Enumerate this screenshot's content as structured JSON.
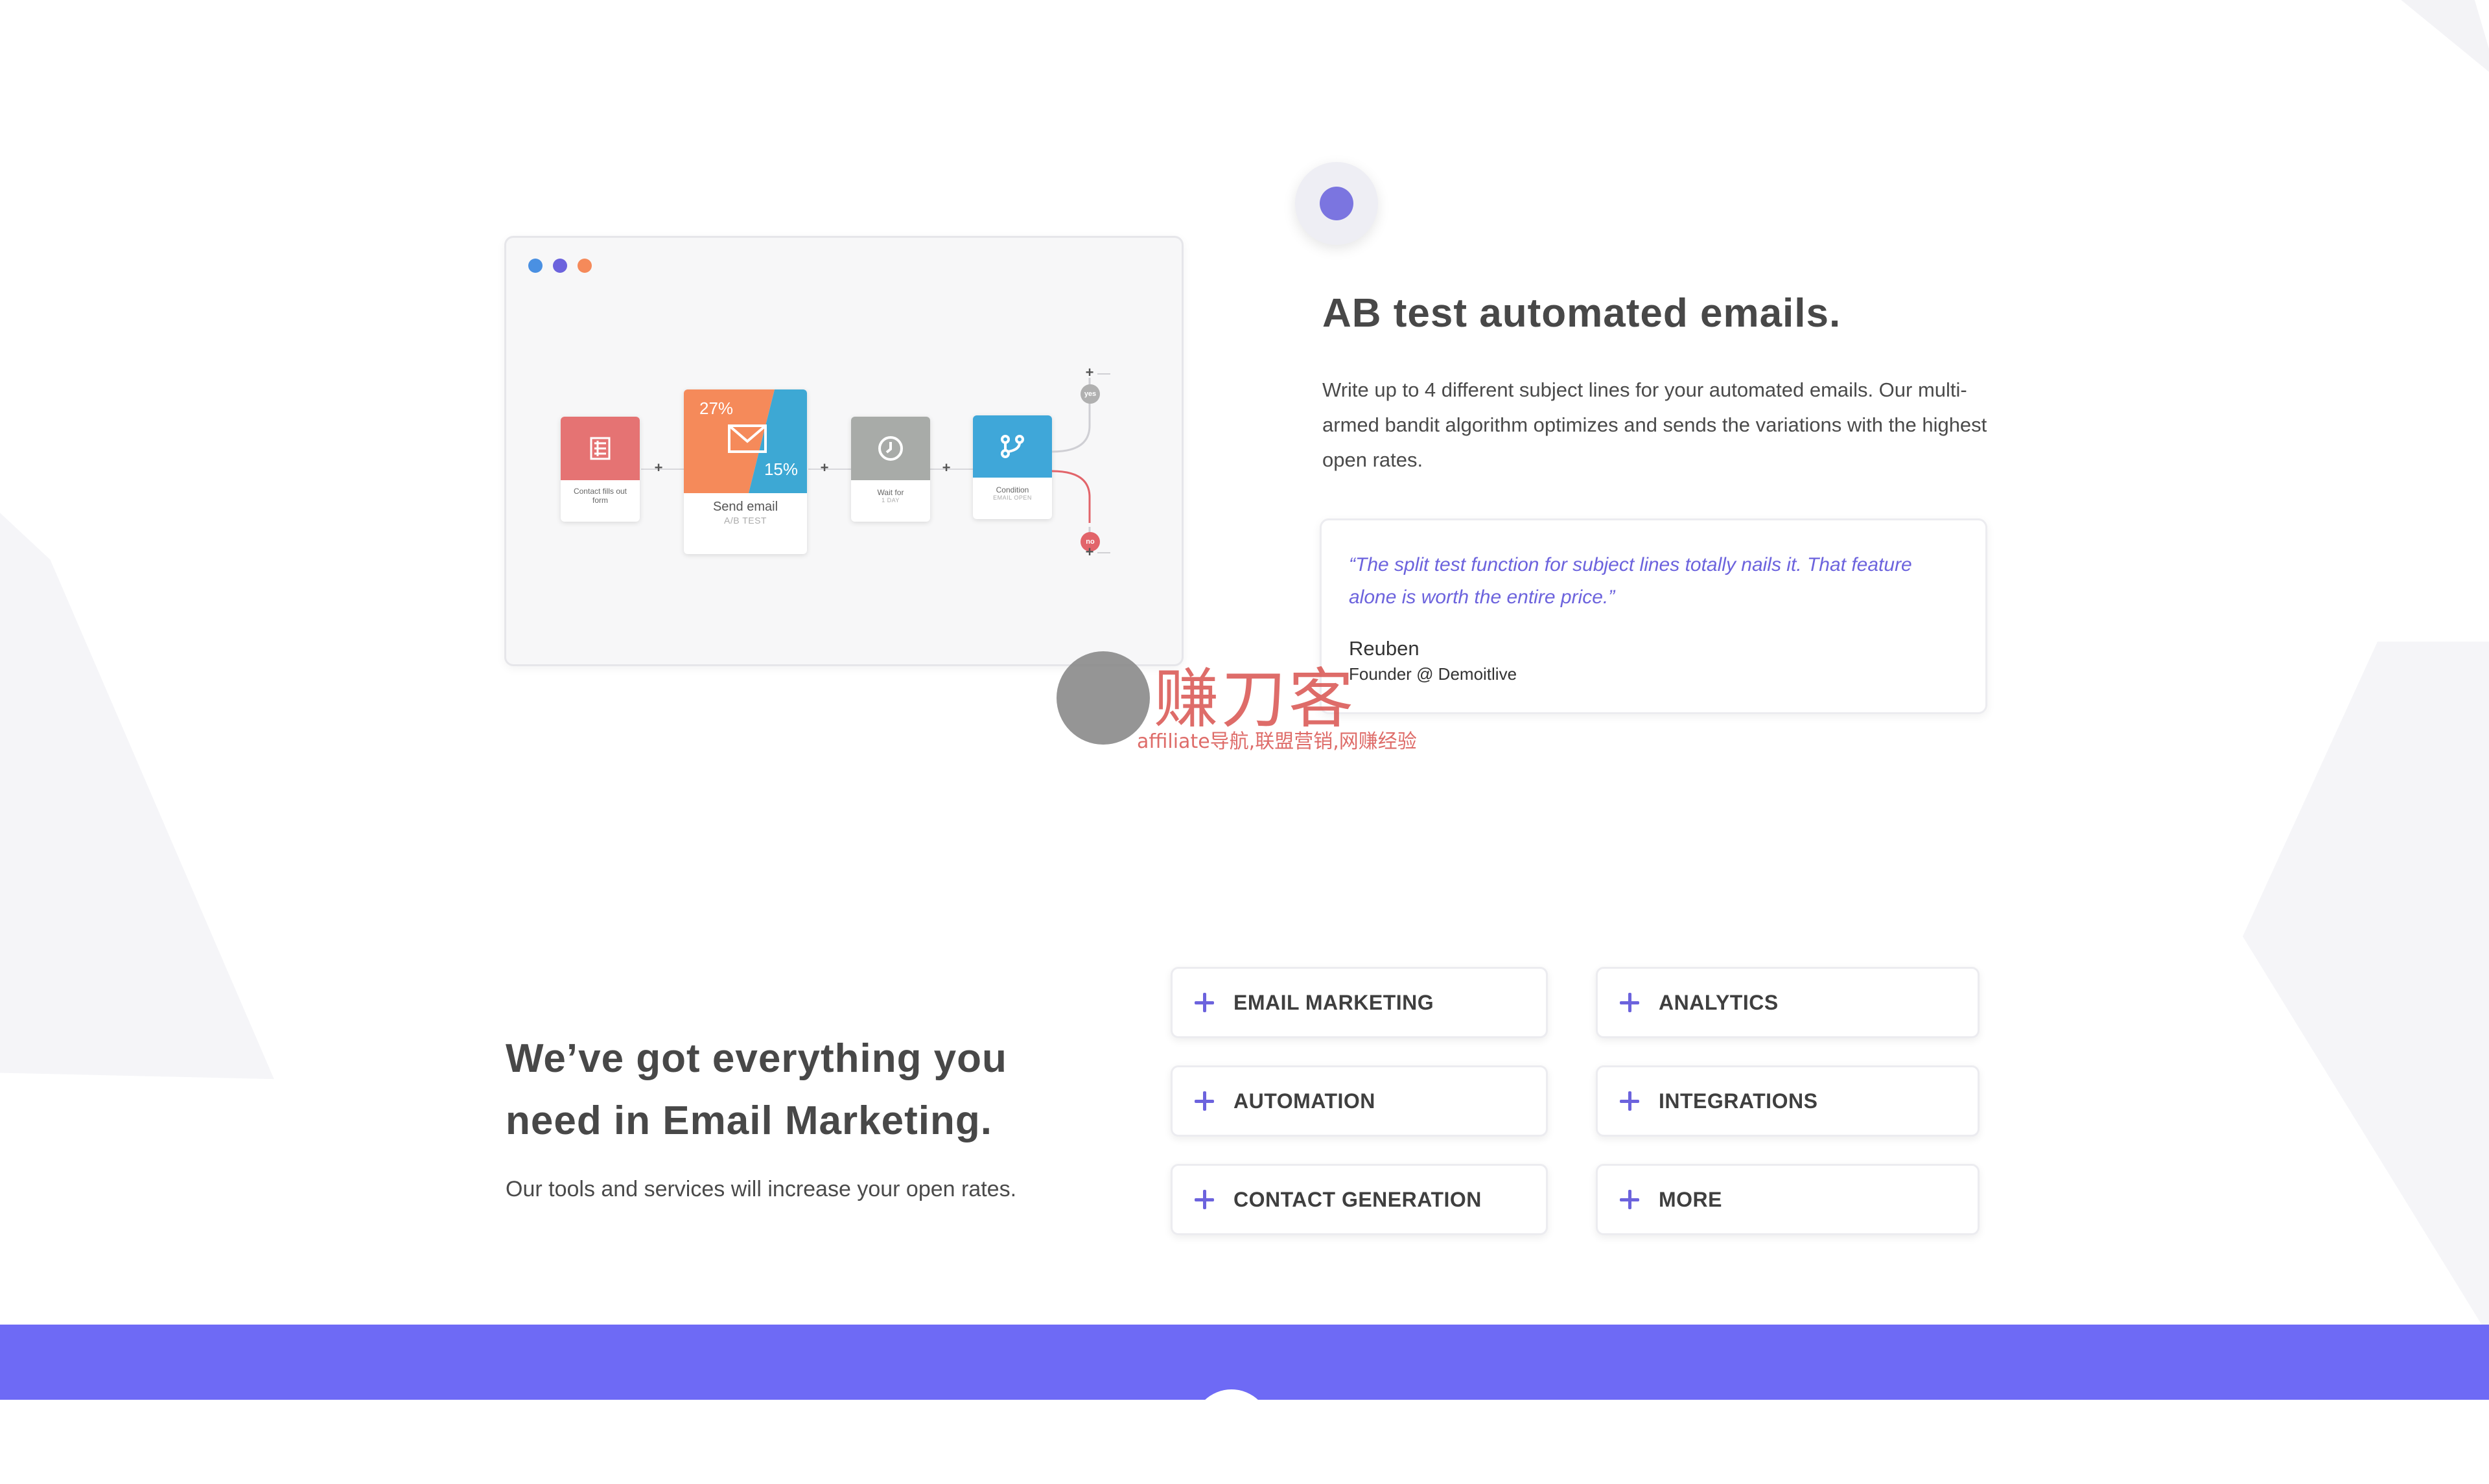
{
  "colors": {
    "accent": "#6c63dd",
    "band": "#6e6af5",
    "dot_blue": "#4a90e2",
    "dot_purple": "#6c63dd",
    "dot_orange": "#f58a5a",
    "node_red": "#e57373",
    "node_orange": "#f58a5a",
    "node_blue": "#3da8d4",
    "node_gray": "#a8aba8",
    "node_cyan": "#3fa7d9",
    "yes_badge": "#b0b0b0",
    "no_badge": "#e2646a",
    "avatar": "#7b75e0"
  },
  "workflow": {
    "node1": {
      "label": "Contact fills out form",
      "icon": "form-icon"
    },
    "node2": {
      "label": "Send email",
      "sub": "A/B TEST",
      "left_pct": "27%",
      "right_pct": "15%",
      "icon": "mail-icon"
    },
    "node3": {
      "label": "Wait for",
      "sub": "1 DAY",
      "icon": "clock-icon"
    },
    "node4": {
      "label": "Condition",
      "sub": "EMAIL OPEN",
      "icon": "branch-icon"
    },
    "yes_label": "yes",
    "no_label": "no"
  },
  "feature_section": {
    "title": "AB test automated emails.",
    "description": "Write up to 4 different subject lines for your automated emails. Our multi-armed bandit algorithm optimizes and sends the variations with the highest open rates.",
    "quote": "“The split test function for subject lines totally nails it. That feature alone is worth the entire price.”",
    "author_name": "Reuben",
    "author_role": "Founder @ Demoitlive"
  },
  "watermark": {
    "cn": "赚刀客",
    "sub": "affiliate导航,联盟营销,网赚经验"
  },
  "everything_section": {
    "title": "We’ve got everything you need in Email Marketing.",
    "description": "Our tools and services will increase your open rates.",
    "features": [
      {
        "label": "EMAIL MARKETING"
      },
      {
        "label": "ANALYTICS"
      },
      {
        "label": "AUTOMATION"
      },
      {
        "label": "INTEGRATIONS"
      },
      {
        "label": "CONTACT GENERATION"
      },
      {
        "label": "MORE"
      }
    ]
  }
}
